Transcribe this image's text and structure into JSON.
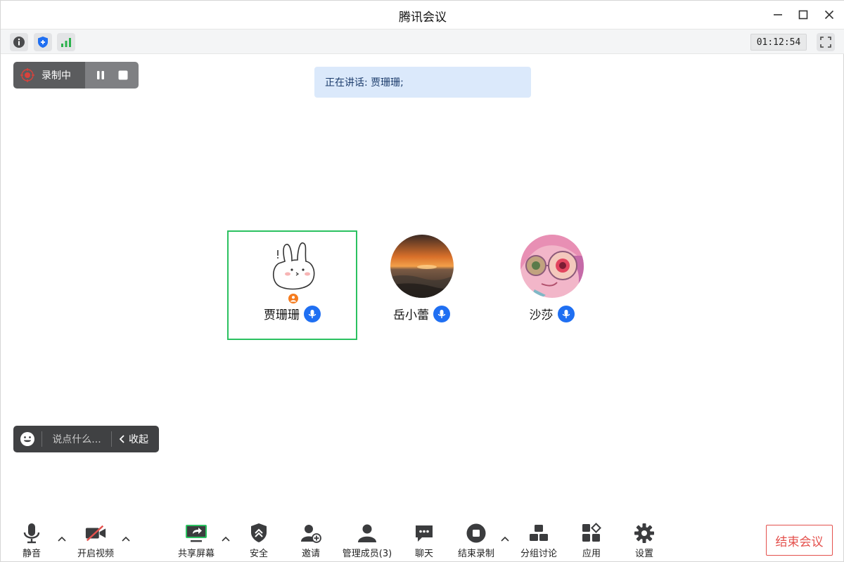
{
  "window": {
    "title": "腾讯会议"
  },
  "statusbar": {
    "timer": "01:12:54"
  },
  "recording": {
    "label": "录制中"
  },
  "speaking": {
    "text": "正在讲话: 贾珊珊;"
  },
  "participants": [
    {
      "name": "贾珊珊",
      "host": true,
      "active": true
    },
    {
      "name": "岳小蕾",
      "host": false,
      "active": false
    },
    {
      "name": "沙莎",
      "host": false,
      "active": false
    }
  ],
  "chat": {
    "placeholder": "说点什么...",
    "collapse_label": "收起"
  },
  "toolbar": {
    "mute": "静音",
    "video": "开启视频",
    "share": "共享屏幕",
    "security": "安全",
    "invite": "邀请",
    "members": "管理成员(3)",
    "chat": "聊天",
    "end_record": "结束录制",
    "breakout": "分组讨论",
    "apps": "应用",
    "settings": "设置",
    "end_meeting": "结束会议"
  },
  "colors": {
    "accent_blue": "#1f6ff2",
    "active_border": "#2bc160",
    "end_red": "#e4514d",
    "host_orange": "#f57c1f",
    "signal_green": "#2bb24c"
  }
}
